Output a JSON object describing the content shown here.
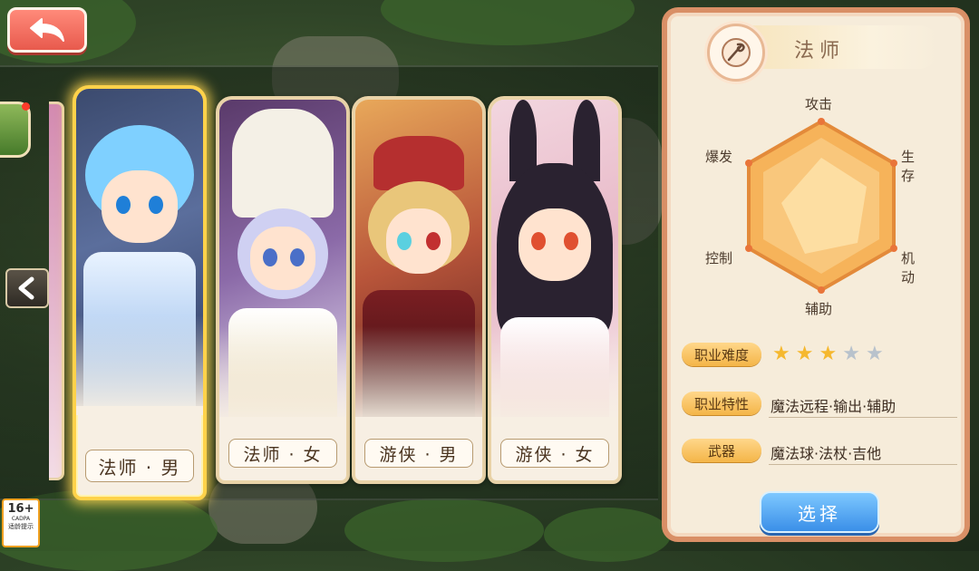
{
  "back_button": {
    "icon": "back-arrow-icon"
  },
  "nav": {
    "prev_icon": "chevron-left-icon"
  },
  "cards": [
    {
      "label": "法师 · 男",
      "selected": true,
      "theme": "#6fc3f2"
    },
    {
      "label": "法师 · 女",
      "selected": false,
      "theme": "#b9b4e8"
    },
    {
      "label": "游侠 · 男",
      "selected": false,
      "theme": "#c0413a"
    },
    {
      "label": "游侠 · 女",
      "selected": false,
      "theme": "#2a2230"
    }
  ],
  "panel": {
    "class_name": "法师",
    "class_icon": "mage-emblem-icon",
    "radar": {
      "attack": "攻击",
      "survival": "生存",
      "mobility": "机动",
      "support": "辅助",
      "control": "控制",
      "burst": "爆发"
    },
    "difficulty": {
      "label": "职业难度",
      "stars_filled": 3,
      "stars_total": 5,
      "star_char": "★"
    },
    "traits": {
      "label": "职业特性",
      "value": "魔法远程·输出·辅助"
    },
    "weapons": {
      "label": "武器",
      "value": "魔法球·法杖·吉他"
    },
    "select_label": "选择"
  },
  "age_rating": {
    "num": "16+",
    "org": "CADPA",
    "tip": "适龄提示"
  },
  "colors": {
    "panel_border": "#d98f66",
    "button_blue": "#3a8fe8",
    "star_gold": "#f5b82e",
    "star_empty": "#b8c2cc"
  }
}
